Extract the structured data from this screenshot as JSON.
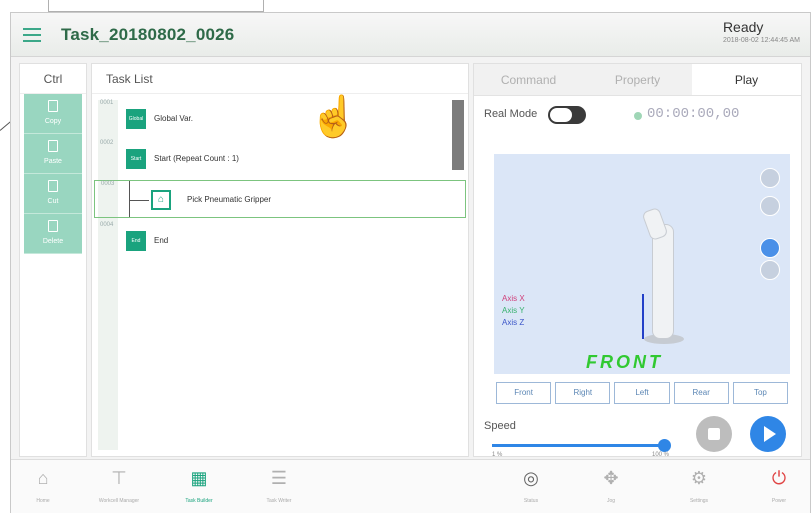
{
  "header": {
    "title": "Task_20180802_0026",
    "status": "Ready",
    "timestamp": "2018-08-02 12:44:45 AM"
  },
  "ctrl": {
    "title": "Ctrl",
    "buttons": [
      "Copy",
      "Paste",
      "Cut",
      "Delete"
    ]
  },
  "task_list": {
    "title": "Task List",
    "rows": [
      {
        "num": "0001",
        "block": "Global Var",
        "label": "Global Var."
      },
      {
        "num": "0002",
        "block": "Start",
        "label": "Start   (Repeat Count : 1)"
      },
      {
        "num": "0003",
        "block": "",
        "label": "Pick Pneumatic Gripper"
      },
      {
        "num": "0004",
        "block": "End",
        "label": "End"
      }
    ]
  },
  "right": {
    "tabs": [
      "Command",
      "Property",
      "Play"
    ],
    "active_tab": "Play",
    "real_mode_label": "Real Mode",
    "timer": "00:00:00,00",
    "axis": [
      "Axis X",
      "Axis Y",
      "Axis Z"
    ],
    "front_label": "FRONT",
    "view_buttons": [
      "Front",
      "Right",
      "Left",
      "Rear",
      "Top"
    ],
    "speed_label": "Speed",
    "speed_min": "1 %",
    "speed_max": "100 %",
    "speed_value_percent": 100
  },
  "bottom_bar": [
    {
      "icon": "home-icon",
      "label": "Home"
    },
    {
      "icon": "workcell-icon",
      "label": "Workcell Manager"
    },
    {
      "icon": "task-builder-icon",
      "label": "Task Builder"
    },
    {
      "icon": "task-writer-icon",
      "label": "Task Writer"
    },
    {
      "icon": "status-icon",
      "label": "Status"
    },
    {
      "icon": "jog-icon",
      "label": "Jog"
    },
    {
      "icon": "settings-icon",
      "label": "Settings"
    },
    {
      "icon": "power-icon",
      "label": "Power"
    }
  ],
  "colors": {
    "accent": "#1aa37e",
    "play": "#2f86e6",
    "power": "#e04545"
  }
}
